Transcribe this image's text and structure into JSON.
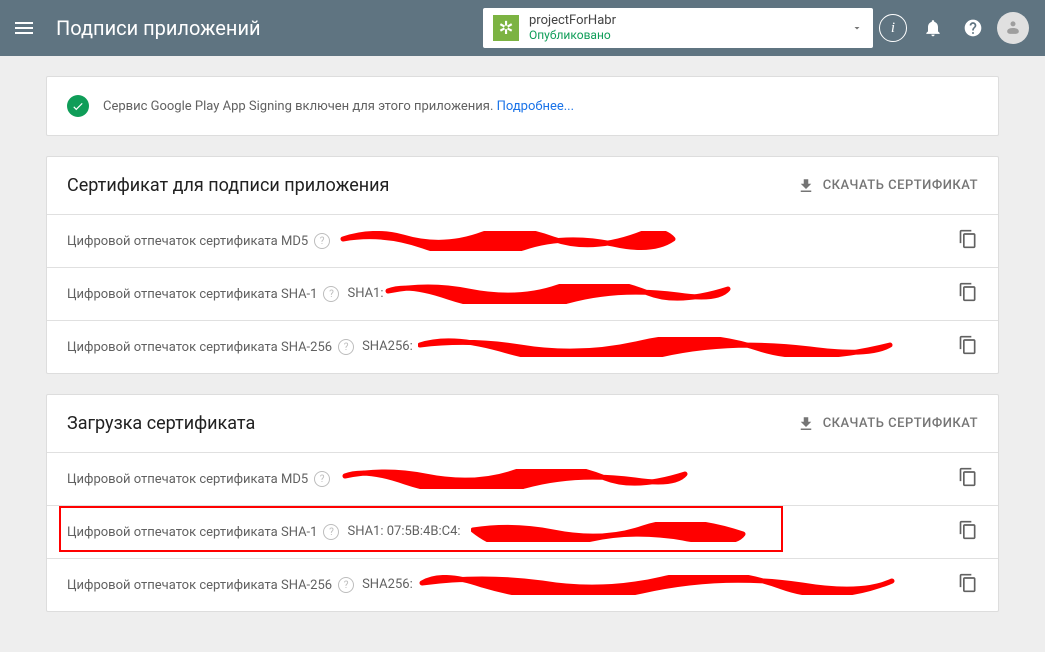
{
  "header": {
    "title": "Подписи приложений",
    "project_name": "projectForHabr",
    "project_status": "Опубликовано"
  },
  "notice": {
    "text": "Сервис Google Play App Signing включен для этого приложения. ",
    "link": "Подробнее..."
  },
  "section1": {
    "title": "Сертификат для подписи приложения",
    "download": "СКАЧАТЬ СЕРТИФИКАТ",
    "rows": [
      {
        "label": "Цифровой отпечаток сертификата MD5",
        "value": ""
      },
      {
        "label": "Цифровой отпечаток сертификата SHA-1",
        "value": "SHA1:"
      },
      {
        "label": "Цифровой отпечаток сертификата SHA-256",
        "value": "SHA256:"
      }
    ]
  },
  "section2": {
    "title": "Загрузка сертификата",
    "download": "СКАЧАТЬ СЕРТИФИКАТ",
    "rows": [
      {
        "label": "Цифровой отпечаток сертификата MD5",
        "value": ""
      },
      {
        "label": "Цифровой отпечаток сертификата SHA-1",
        "value": "SHA1: 07:5B:4B:C4:"
      },
      {
        "label": "Цифровой отпечаток сертификата SHA-256",
        "value": "SHA256:"
      }
    ]
  }
}
